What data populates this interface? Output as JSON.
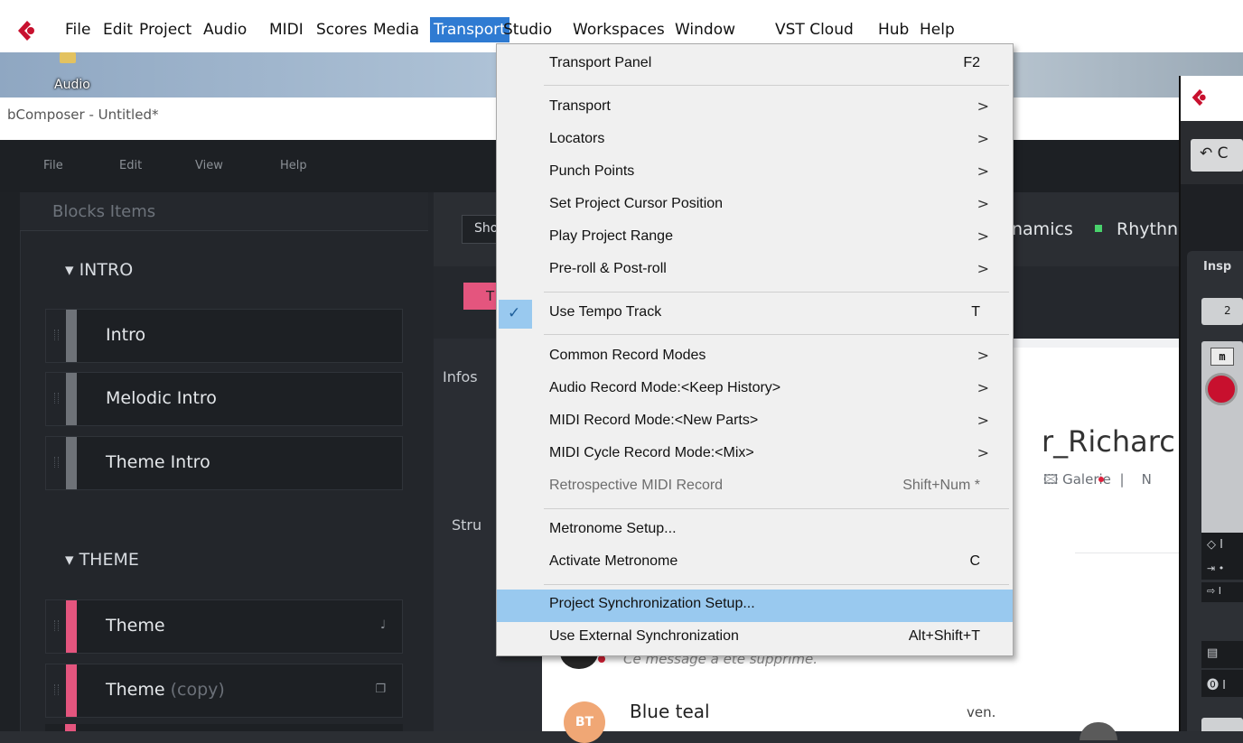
{
  "menubar": {
    "items": [
      "File",
      "Edit",
      "Project",
      "Audio",
      "MIDI",
      "Scores",
      "Media",
      "Transport",
      "Studio",
      "Workspaces",
      "Window",
      "VST Cloud",
      "Hub",
      "Help"
    ],
    "active": "Transport"
  },
  "desktop": {
    "audio_label": "Audio"
  },
  "app": {
    "title": "bComposer - Untitled*",
    "menu": [
      "File",
      "Edit",
      "View",
      "Help"
    ]
  },
  "blocks": {
    "title": "Blocks Items",
    "sections": [
      {
        "name": "INTRO",
        "items": [
          {
            "label": "Intro",
            "color": "#6e7278",
            "suffix": ""
          },
          {
            "label": "Melodic Intro",
            "color": "#6e7278",
            "suffix": ""
          },
          {
            "label": "Theme Intro",
            "color": "#6e7278",
            "suffix": ""
          }
        ]
      },
      {
        "name": "THEME",
        "items": [
          {
            "label": "Theme",
            "color": "#e4557e",
            "suffix": ""
          },
          {
            "label": "Theme",
            "color": "#e4557e",
            "suffix": "(copy)"
          }
        ]
      }
    ]
  },
  "center": {
    "show_button": "Sho",
    "tag_label": "T",
    "infos_label": "Infos",
    "stru_label": "Stru",
    "dynamics_label": "namics",
    "rhythm_label": "Rhythn"
  },
  "messages": {
    "profile_name": "r_Richarc",
    "galerie_label": "Galerie",
    "galerie_sep": "|",
    "galerie_n": "N",
    "deleted_msg": "Ce message a été supprimé.",
    "contact_initials": "BT",
    "contact_name": "Blue teal",
    "contact_time": "ven."
  },
  "right_window": {
    "undo_label": "↶ C",
    "insp_label": "Insp",
    "insp_btn": "2",
    "m_btn": "m",
    "rows": [
      "◇ I",
      "⇥ •",
      "⇨ I",
      "▤",
      "⓿ I"
    ]
  },
  "transport_menu": {
    "items": [
      {
        "label": "Transport Panel",
        "shortcut": "F2",
        "submenu": false
      },
      {
        "label": "Transport",
        "shortcut": "",
        "submenu": true
      },
      {
        "label": "Locators",
        "shortcut": "",
        "submenu": true
      },
      {
        "label": "Punch Points",
        "shortcut": "",
        "submenu": true
      },
      {
        "label": "Set Project Cursor Position",
        "shortcut": "",
        "submenu": true
      },
      {
        "label": "Play Project Range",
        "shortcut": "",
        "submenu": true
      },
      {
        "label": "Pre-roll & Post-roll",
        "shortcut": "",
        "submenu": true
      },
      {
        "label": "Use Tempo Track",
        "shortcut": "T",
        "submenu": false,
        "checked": true
      },
      {
        "label": "Common Record Modes",
        "shortcut": "",
        "submenu": true
      },
      {
        "label": "Audio Record Mode:<Keep History>",
        "shortcut": "",
        "submenu": true
      },
      {
        "label": "MIDI Record Mode:<New Parts>",
        "shortcut": "",
        "submenu": true
      },
      {
        "label": "MIDI Cycle Record Mode:<Mix>",
        "shortcut": "",
        "submenu": true
      },
      {
        "label": "Retrospective MIDI Record",
        "shortcut": "Shift+Num *",
        "submenu": false,
        "disabled": true
      },
      {
        "label": "Metronome Setup...",
        "shortcut": "",
        "submenu": false
      },
      {
        "label": "Activate Metronome",
        "shortcut": "C",
        "submenu": false
      },
      {
        "label": "Project Synchronization Setup...",
        "shortcut": "",
        "submenu": false,
        "highlighted": true
      },
      {
        "label": "Use External Synchronization",
        "shortcut": "Alt+Shift+T",
        "submenu": false
      }
    ],
    "submenu_arrow": ">"
  },
  "colors": {
    "menu_highlight": "#99c9ef",
    "active_top_menu": "#2f7bd2",
    "intro_bar": "#6e7278",
    "theme_bar": "#e4557e",
    "cubase_red": "#c8102e"
  }
}
